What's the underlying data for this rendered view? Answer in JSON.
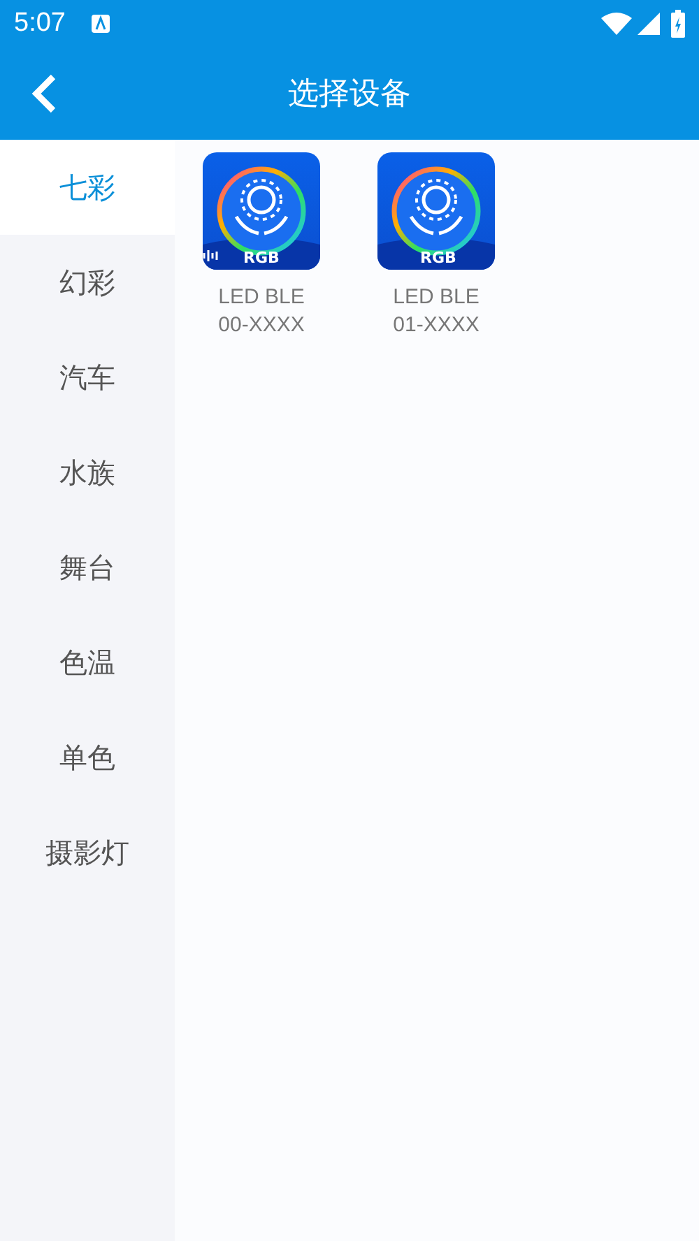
{
  "status_bar": {
    "time": "5:07"
  },
  "app_bar": {
    "title": "选择设备"
  },
  "sidebar": {
    "items": [
      {
        "label": "七彩",
        "selected": true
      },
      {
        "label": "幻彩",
        "selected": false
      },
      {
        "label": "汽车",
        "selected": false
      },
      {
        "label": "水族",
        "selected": false
      },
      {
        "label": "舞台",
        "selected": false
      },
      {
        "label": "色温",
        "selected": false
      },
      {
        "label": "单色",
        "selected": false
      },
      {
        "label": "摄影灯",
        "selected": false
      }
    ]
  },
  "devices": [
    {
      "badge": "RGB",
      "sound": true,
      "name": "LED BLE\n00-XXXX"
    },
    {
      "badge": "RGB",
      "sound": false,
      "name": "LED BLE\n01-XXXX"
    }
  ]
}
